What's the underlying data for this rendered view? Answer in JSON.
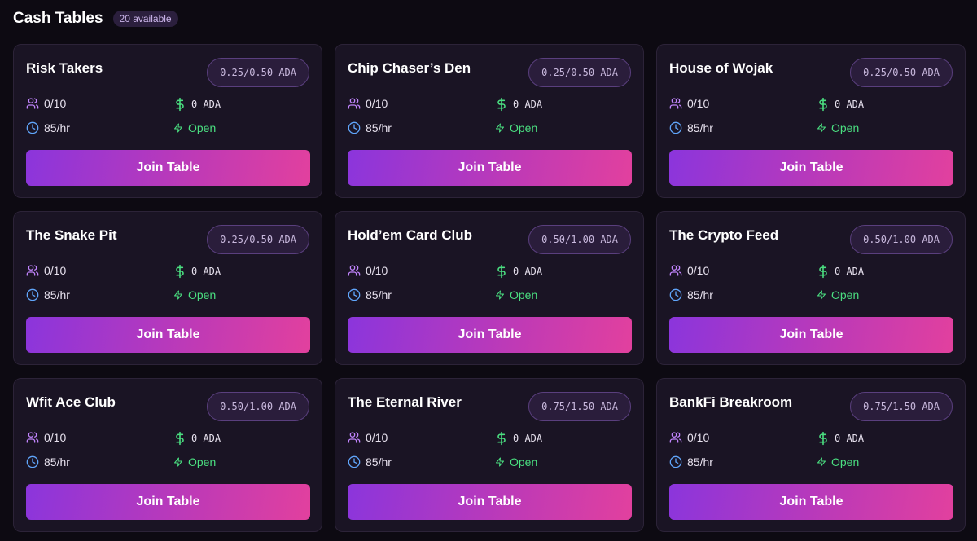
{
  "header": {
    "title": "Cash Tables",
    "count_badge": "20 available"
  },
  "colors": {
    "background": "#0d0a12",
    "card": "#1a1424",
    "accent_start": "#8b35dc",
    "accent_end": "#e2409e",
    "status_open": "#4ade80",
    "players_icon": "#c084fc",
    "pot_icon": "#4ade80",
    "clock_icon": "#60a5fa"
  },
  "icons": {
    "players": "users-icon",
    "pot": "dollar-icon",
    "rate": "clock-icon",
    "status": "lightning-icon"
  },
  "tables": [
    {
      "name": "Risk Takers",
      "stakes": "0.25/0.50 ADA",
      "players": "0/10",
      "pot": "0 ADA",
      "rate": "85/hr",
      "status": "Open",
      "button": "Join Table"
    },
    {
      "name": "Chip Chaser’s Den",
      "stakes": "0.25/0.50 ADA",
      "players": "0/10",
      "pot": "0 ADA",
      "rate": "85/hr",
      "status": "Open",
      "button": "Join Table"
    },
    {
      "name": "House of Wojak",
      "stakes": "0.25/0.50 ADA",
      "players": "0/10",
      "pot": "0 ADA",
      "rate": "85/hr",
      "status": "Open",
      "button": "Join Table"
    },
    {
      "name": "The Snake Pit",
      "stakes": "0.25/0.50 ADA",
      "players": "0/10",
      "pot": "0 ADA",
      "rate": "85/hr",
      "status": "Open",
      "button": "Join Table"
    },
    {
      "name": "Hold’em Card Club",
      "stakes": "0.50/1.00 ADA",
      "players": "0/10",
      "pot": "0 ADA",
      "rate": "85/hr",
      "status": "Open",
      "button": "Join Table"
    },
    {
      "name": "The Crypto Feed",
      "stakes": "0.50/1.00 ADA",
      "players": "0/10",
      "pot": "0 ADA",
      "rate": "85/hr",
      "status": "Open",
      "button": "Join Table"
    },
    {
      "name": "Wfit Ace Club",
      "stakes": "0.50/1.00 ADA",
      "players": "0/10",
      "pot": "0 ADA",
      "rate": "85/hr",
      "status": "Open",
      "button": "Join Table"
    },
    {
      "name": "The Eternal River",
      "stakes": "0.75/1.50 ADA",
      "players": "0/10",
      "pot": "0 ADA",
      "rate": "85/hr",
      "status": "Open",
      "button": "Join Table"
    },
    {
      "name": "BankFi Breakroom",
      "stakes": "0.75/1.50 ADA",
      "players": "0/10",
      "pot": "0 ADA",
      "rate": "85/hr",
      "status": "Open",
      "button": "Join Table"
    }
  ]
}
